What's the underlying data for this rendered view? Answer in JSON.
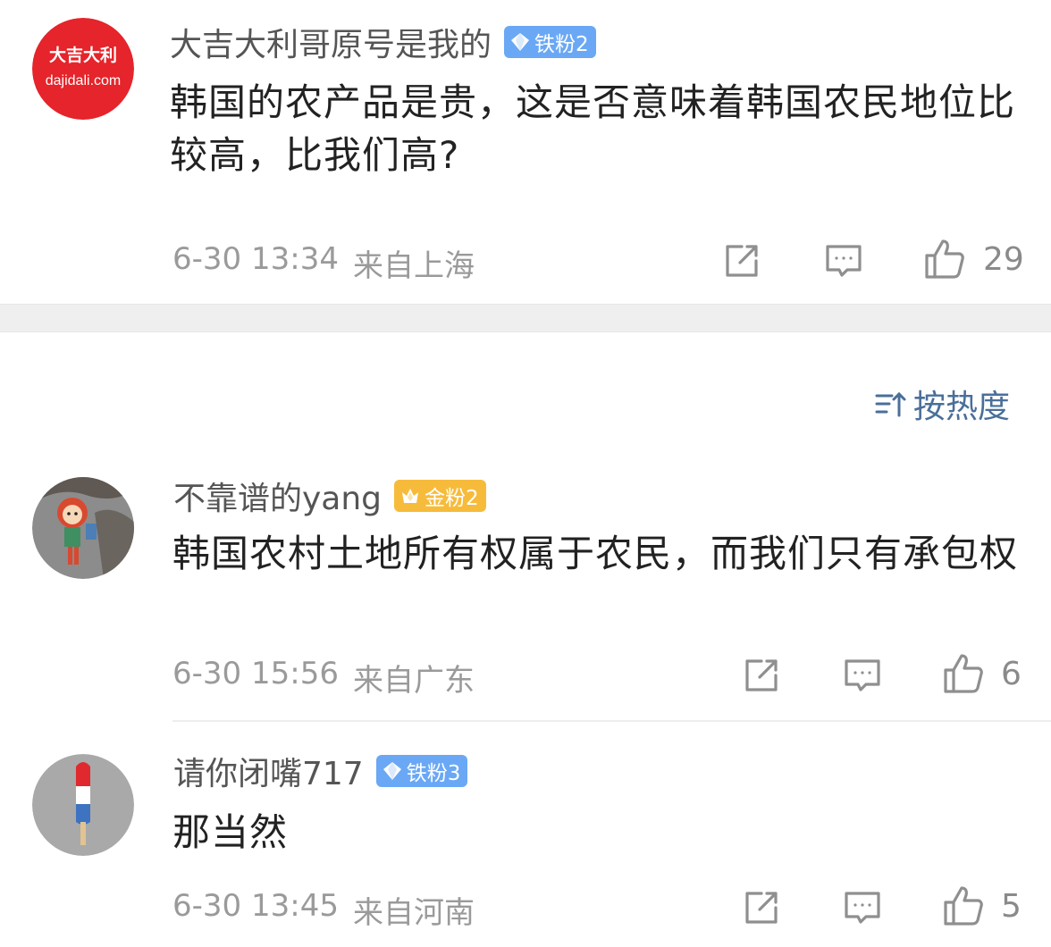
{
  "comments": [
    {
      "avatar_text_top": "大吉大利",
      "avatar_text_bottom": "dajidali.com",
      "username": "大吉大利哥原号是我的",
      "badge": "铁粉2",
      "content": "韩国的农产品是贵，这是否意味着韩国农民地位比较高，比我们高?",
      "date": "6-30 13:34",
      "location": "来自上海",
      "likes": "29"
    },
    {
      "username": "不靠谱的yang",
      "badge": "金粉2",
      "content": "韩国农村土地所有权属于农民，而我们只有承包权",
      "date": "6-30 15:56",
      "location": "来自广东",
      "likes": "6"
    },
    {
      "username": "请你闭嘴717",
      "badge": "铁粉3",
      "content": "那当然",
      "date": "6-30 13:45",
      "location": "来自河南",
      "likes": "5"
    }
  ],
  "sort": {
    "label": "按热度",
    "icon": "sort-icon"
  },
  "icons": {
    "share": "share-icon",
    "comment": "comment-icon",
    "like": "thumbs-up-icon",
    "iron_fan": "diamond-icon",
    "gold_fan": "crown-icon"
  },
  "colors": {
    "iron_badge": "#6aa8f5",
    "gold_badge": "#f7bb3b",
    "sort_text": "#4a6f99",
    "avatar_red": "#e5242b"
  }
}
